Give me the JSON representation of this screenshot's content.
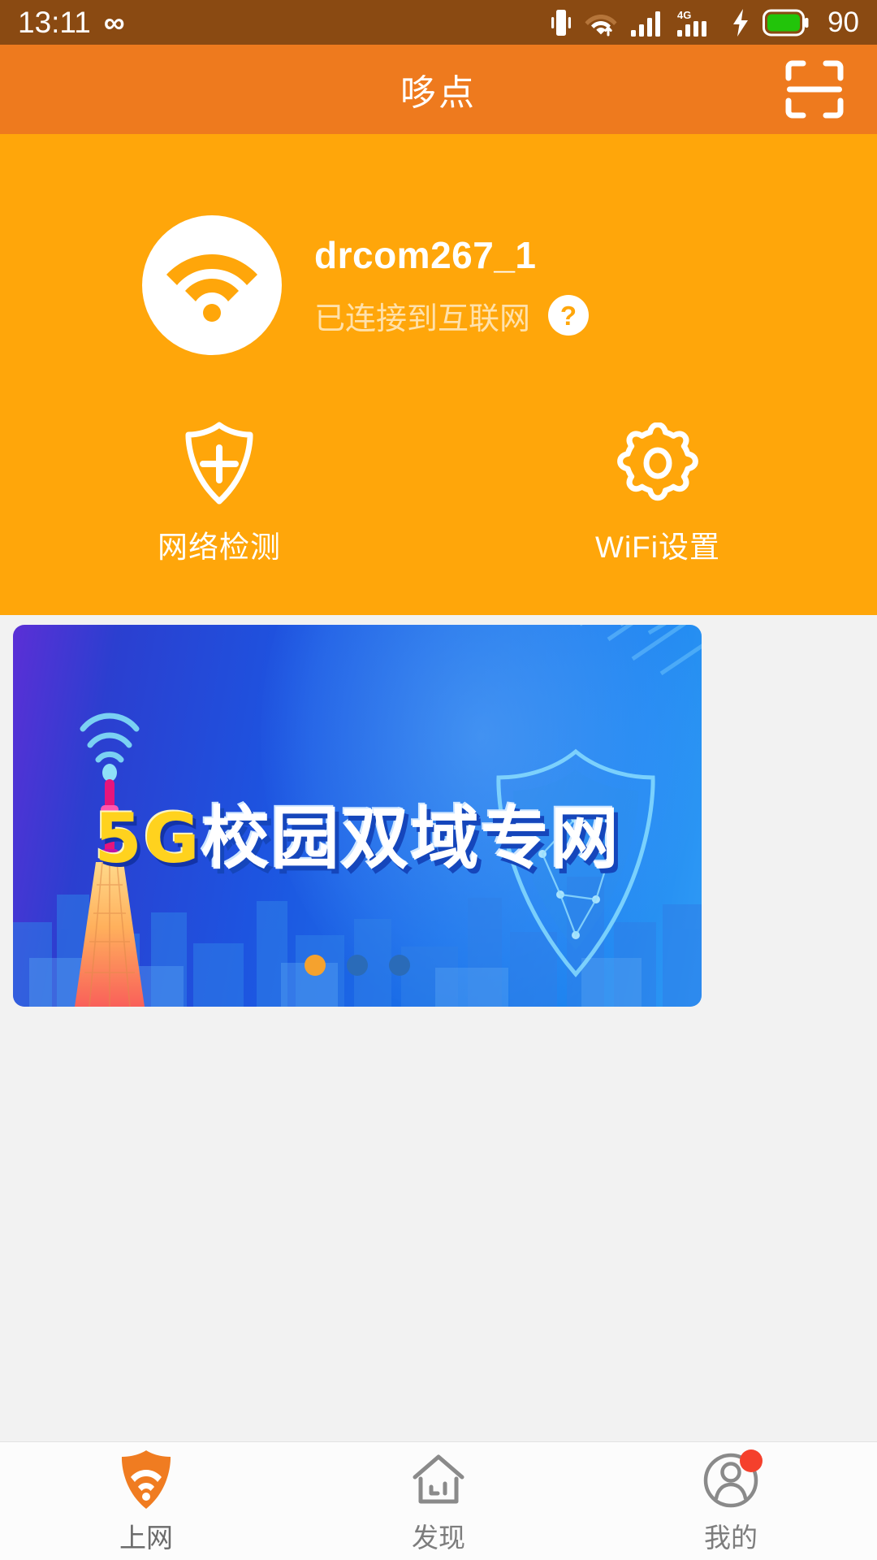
{
  "status_bar": {
    "time": "13:11",
    "infinity_icon": "infinity-icon",
    "vibrate_icon": "vibrate-icon",
    "wifi_icon": "wifi-data-icon",
    "signal_icon": "signal-bars-icon",
    "network_type": "4G",
    "signal2_icon": "signal-bars-4g-icon",
    "charging_icon": "charging-bolt-icon",
    "battery_level": "90",
    "background_color": "#8a4a12",
    "battery_color": "#22c40a"
  },
  "header": {
    "title": "哆点",
    "scan_icon": "scan-qr-icon",
    "background_color": "#ee7a1e"
  },
  "wifi_card": {
    "background_color": "#ffa60a",
    "wifi_icon": "wifi-icon",
    "ssid": "drcom267_1",
    "status_text": "已连接到互联网",
    "help_icon": "help-circle-icon",
    "actions": [
      {
        "label": "网络检测",
        "icon": "shield-plus-icon"
      },
      {
        "label": "WiFi设置",
        "icon": "gear-icon"
      }
    ]
  },
  "banner": {
    "title_highlight": "5G",
    "title_rest": "校园双域专网",
    "highlight_color": "#ffd21e",
    "active_dot_color": "#f5a22e",
    "dots": [
      {
        "active": true
      },
      {
        "active": false
      },
      {
        "active": false
      }
    ]
  },
  "tabbar": {
    "items": [
      {
        "label": "上网",
        "icon": "shield-wifi-icon",
        "active": true,
        "badge": false
      },
      {
        "label": "发现",
        "icon": "home-icon",
        "active": false,
        "badge": false
      },
      {
        "label": "我的",
        "icon": "person-icon",
        "active": false,
        "badge": true
      }
    ],
    "active_color": "#f07c21",
    "inactive_color": "#8a8a8a",
    "badge_color": "#f5402c"
  }
}
